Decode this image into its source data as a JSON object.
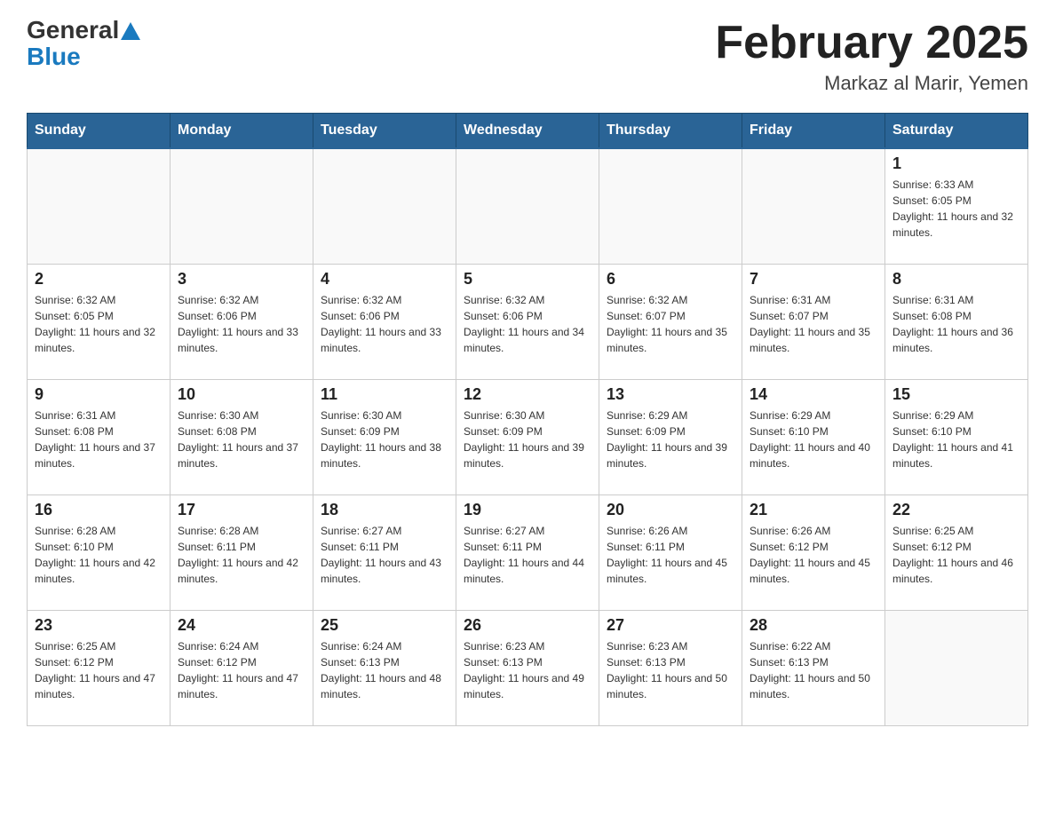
{
  "header": {
    "logo_general": "General",
    "logo_blue": "Blue",
    "month_title": "February 2025",
    "location": "Markaz al Marir, Yemen"
  },
  "days_of_week": [
    "Sunday",
    "Monday",
    "Tuesday",
    "Wednesday",
    "Thursday",
    "Friday",
    "Saturday"
  ],
  "weeks": [
    [
      {
        "day": "",
        "sunrise": "",
        "sunset": "",
        "daylight": ""
      },
      {
        "day": "",
        "sunrise": "",
        "sunset": "",
        "daylight": ""
      },
      {
        "day": "",
        "sunrise": "",
        "sunset": "",
        "daylight": ""
      },
      {
        "day": "",
        "sunrise": "",
        "sunset": "",
        "daylight": ""
      },
      {
        "day": "",
        "sunrise": "",
        "sunset": "",
        "daylight": ""
      },
      {
        "day": "",
        "sunrise": "",
        "sunset": "",
        "daylight": ""
      },
      {
        "day": "1",
        "sunrise": "Sunrise: 6:33 AM",
        "sunset": "Sunset: 6:05 PM",
        "daylight": "Daylight: 11 hours and 32 minutes."
      }
    ],
    [
      {
        "day": "2",
        "sunrise": "Sunrise: 6:32 AM",
        "sunset": "Sunset: 6:05 PM",
        "daylight": "Daylight: 11 hours and 32 minutes."
      },
      {
        "day": "3",
        "sunrise": "Sunrise: 6:32 AM",
        "sunset": "Sunset: 6:06 PM",
        "daylight": "Daylight: 11 hours and 33 minutes."
      },
      {
        "day": "4",
        "sunrise": "Sunrise: 6:32 AM",
        "sunset": "Sunset: 6:06 PM",
        "daylight": "Daylight: 11 hours and 33 minutes."
      },
      {
        "day": "5",
        "sunrise": "Sunrise: 6:32 AM",
        "sunset": "Sunset: 6:06 PM",
        "daylight": "Daylight: 11 hours and 34 minutes."
      },
      {
        "day": "6",
        "sunrise": "Sunrise: 6:32 AM",
        "sunset": "Sunset: 6:07 PM",
        "daylight": "Daylight: 11 hours and 35 minutes."
      },
      {
        "day": "7",
        "sunrise": "Sunrise: 6:31 AM",
        "sunset": "Sunset: 6:07 PM",
        "daylight": "Daylight: 11 hours and 35 minutes."
      },
      {
        "day": "8",
        "sunrise": "Sunrise: 6:31 AM",
        "sunset": "Sunset: 6:08 PM",
        "daylight": "Daylight: 11 hours and 36 minutes."
      }
    ],
    [
      {
        "day": "9",
        "sunrise": "Sunrise: 6:31 AM",
        "sunset": "Sunset: 6:08 PM",
        "daylight": "Daylight: 11 hours and 37 minutes."
      },
      {
        "day": "10",
        "sunrise": "Sunrise: 6:30 AM",
        "sunset": "Sunset: 6:08 PM",
        "daylight": "Daylight: 11 hours and 37 minutes."
      },
      {
        "day": "11",
        "sunrise": "Sunrise: 6:30 AM",
        "sunset": "Sunset: 6:09 PM",
        "daylight": "Daylight: 11 hours and 38 minutes."
      },
      {
        "day": "12",
        "sunrise": "Sunrise: 6:30 AM",
        "sunset": "Sunset: 6:09 PM",
        "daylight": "Daylight: 11 hours and 39 minutes."
      },
      {
        "day": "13",
        "sunrise": "Sunrise: 6:29 AM",
        "sunset": "Sunset: 6:09 PM",
        "daylight": "Daylight: 11 hours and 39 minutes."
      },
      {
        "day": "14",
        "sunrise": "Sunrise: 6:29 AM",
        "sunset": "Sunset: 6:10 PM",
        "daylight": "Daylight: 11 hours and 40 minutes."
      },
      {
        "day": "15",
        "sunrise": "Sunrise: 6:29 AM",
        "sunset": "Sunset: 6:10 PM",
        "daylight": "Daylight: 11 hours and 41 minutes."
      }
    ],
    [
      {
        "day": "16",
        "sunrise": "Sunrise: 6:28 AM",
        "sunset": "Sunset: 6:10 PM",
        "daylight": "Daylight: 11 hours and 42 minutes."
      },
      {
        "day": "17",
        "sunrise": "Sunrise: 6:28 AM",
        "sunset": "Sunset: 6:11 PM",
        "daylight": "Daylight: 11 hours and 42 minutes."
      },
      {
        "day": "18",
        "sunrise": "Sunrise: 6:27 AM",
        "sunset": "Sunset: 6:11 PM",
        "daylight": "Daylight: 11 hours and 43 minutes."
      },
      {
        "day": "19",
        "sunrise": "Sunrise: 6:27 AM",
        "sunset": "Sunset: 6:11 PM",
        "daylight": "Daylight: 11 hours and 44 minutes."
      },
      {
        "day": "20",
        "sunrise": "Sunrise: 6:26 AM",
        "sunset": "Sunset: 6:11 PM",
        "daylight": "Daylight: 11 hours and 45 minutes."
      },
      {
        "day": "21",
        "sunrise": "Sunrise: 6:26 AM",
        "sunset": "Sunset: 6:12 PM",
        "daylight": "Daylight: 11 hours and 45 minutes."
      },
      {
        "day": "22",
        "sunrise": "Sunrise: 6:25 AM",
        "sunset": "Sunset: 6:12 PM",
        "daylight": "Daylight: 11 hours and 46 minutes."
      }
    ],
    [
      {
        "day": "23",
        "sunrise": "Sunrise: 6:25 AM",
        "sunset": "Sunset: 6:12 PM",
        "daylight": "Daylight: 11 hours and 47 minutes."
      },
      {
        "day": "24",
        "sunrise": "Sunrise: 6:24 AM",
        "sunset": "Sunset: 6:12 PM",
        "daylight": "Daylight: 11 hours and 47 minutes."
      },
      {
        "day": "25",
        "sunrise": "Sunrise: 6:24 AM",
        "sunset": "Sunset: 6:13 PM",
        "daylight": "Daylight: 11 hours and 48 minutes."
      },
      {
        "day": "26",
        "sunrise": "Sunrise: 6:23 AM",
        "sunset": "Sunset: 6:13 PM",
        "daylight": "Daylight: 11 hours and 49 minutes."
      },
      {
        "day": "27",
        "sunrise": "Sunrise: 6:23 AM",
        "sunset": "Sunset: 6:13 PM",
        "daylight": "Daylight: 11 hours and 50 minutes."
      },
      {
        "day": "28",
        "sunrise": "Sunrise: 6:22 AM",
        "sunset": "Sunset: 6:13 PM",
        "daylight": "Daylight: 11 hours and 50 minutes."
      },
      {
        "day": "",
        "sunrise": "",
        "sunset": "",
        "daylight": ""
      }
    ]
  ]
}
